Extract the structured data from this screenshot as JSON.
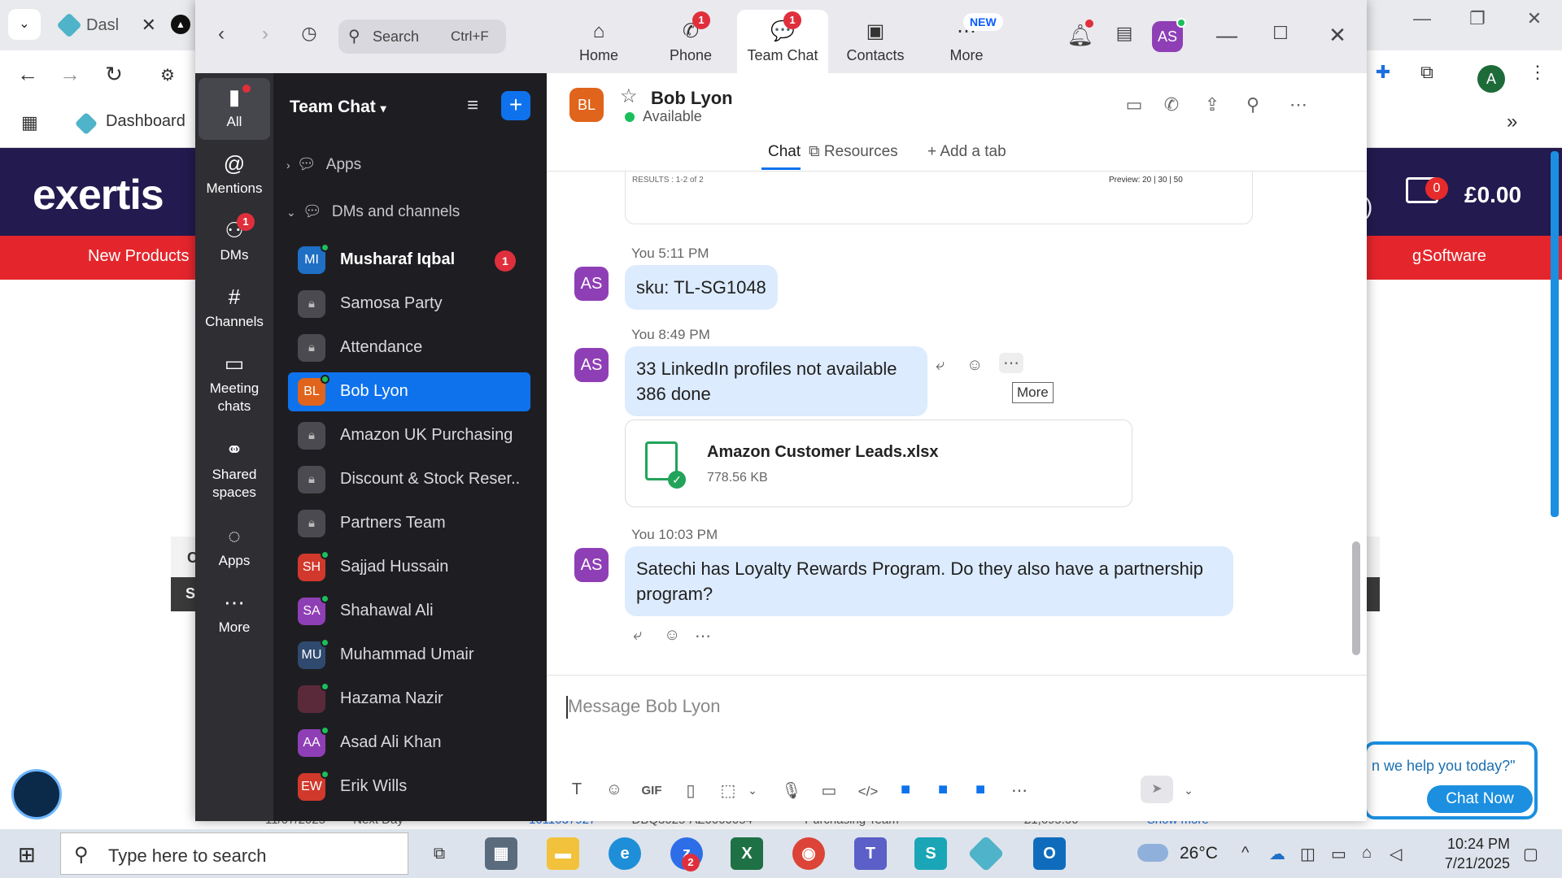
{
  "browser": {
    "tab_title": "Dasl",
    "bookmark_dashboard": "Dashboard",
    "profile_initial": "A"
  },
  "website": {
    "logo": "exertis",
    "cart_count": "0",
    "cart_total": "£0.00",
    "header_fragment": ")",
    "nav": {
      "new_products": "New Products",
      "fragment": "g",
      "software": "Software"
    },
    "left_fragments": [
      "C",
      "S"
    ],
    "chat_prompt": "n we help you today?\"",
    "chat_button": "Chat Now",
    "bottom_fragments": [
      "11/07/2025",
      "Next Day",
      "1011037927",
      "DBQ3025-AZ0000054",
      "Purchasing Team",
      "£1,695.00",
      "Show more"
    ]
  },
  "zoom": {
    "search": {
      "placeholder": "Search",
      "shortcut": "Ctrl+F"
    },
    "tabs": [
      {
        "label": "Home",
        "icon": "home-icon"
      },
      {
        "label": "Phone",
        "icon": "phone-icon",
        "badge": "1"
      },
      {
        "label": "Team Chat",
        "icon": "chat-icon",
        "badge": "1"
      },
      {
        "label": "Contacts",
        "icon": "contacts-icon"
      },
      {
        "label": "More",
        "icon": "more-icon",
        "tag": "NEW"
      }
    ],
    "user_initials": "AS",
    "rail": [
      {
        "label": "All",
        "icon": "chat-bubble-icon"
      },
      {
        "label": "Mentions",
        "icon": "at-icon"
      },
      {
        "label": "DMs",
        "icon": "people-icon",
        "badge": "1"
      },
      {
        "label": "Channels",
        "icon": "hash-icon"
      },
      {
        "label": "Meeting chats",
        "icon": "calendar-icon"
      },
      {
        "label": "Shared spaces",
        "icon": "share-icon"
      },
      {
        "label": "Apps",
        "icon": "apps-icon"
      },
      {
        "label": "More",
        "icon": "ellipsis-icon"
      }
    ],
    "list": {
      "title": "Team Chat",
      "section_apps": "Apps",
      "section_dms": "DMs and channels",
      "items": [
        {
          "initials": "MI",
          "name": "Musharaf Iqbal",
          "count": "1",
          "color": "#1f6fc4"
        },
        {
          "name": "Samosa Party",
          "locked": true
        },
        {
          "name": "Attendance",
          "locked": true
        },
        {
          "initials": "BL",
          "name": "Bob Lyon",
          "color": "#e0641b"
        },
        {
          "name": "Amazon UK Purchasing",
          "locked": true
        },
        {
          "name": "Discount & Stock Reser...",
          "locked": true
        },
        {
          "name": "Partners Team",
          "locked": true
        },
        {
          "initials": "SH",
          "name": "Sajjad Hussain",
          "color": "#d0392b"
        },
        {
          "initials": "SA",
          "name": "Shahawal Ali",
          "color": "#8f3fb5"
        },
        {
          "initials": "MU",
          "name": "Muhammad Umair",
          "color": "#2f4a6e"
        },
        {
          "initials": "",
          "name": "Hazama Nazir",
          "color": "#5a2a3a"
        },
        {
          "initials": "AA",
          "name": "Asad Ali Khan",
          "color": "#8f3fb5"
        },
        {
          "initials": "EW",
          "name": "Erik Wills",
          "color": "#d0392b"
        }
      ]
    },
    "chat": {
      "contact_initials": "BL",
      "contact_name": "Bob Lyon",
      "contact_status": "Available",
      "tabs": [
        "Chat",
        "Resources",
        "Add a tab"
      ],
      "card_results": "RESULTS : 1-2 of 2",
      "card_preview": "Preview: 20 | 30 | 50",
      "messages": [
        {
          "sender": "You",
          "time": "5:11 PM",
          "initials": "AS",
          "text": "sku: TL-SG1048"
        },
        {
          "sender": "You",
          "time": "8:49 PM",
          "initials": "AS",
          "line1": "33 LinkedIn profiles not available",
          "line2": "386 done"
        },
        {
          "sender": "You",
          "time": "10:03 PM",
          "initials": "AS",
          "line1": "Satechi has Loyalty Rewards Program. Do they also have a partnership",
          "line2": "program?"
        }
      ],
      "tooltip": "More",
      "file": {
        "name": "Amazon Customer Leads.xlsx",
        "size": "778.56 KB"
      },
      "compose_placeholder": "Message Bob Lyon"
    }
  },
  "taskbar": {
    "search_placeholder": "Type here to search",
    "zoom_badge": "2",
    "temperature": "26°C",
    "time": "10:24 PM",
    "date": "7/21/2025"
  }
}
